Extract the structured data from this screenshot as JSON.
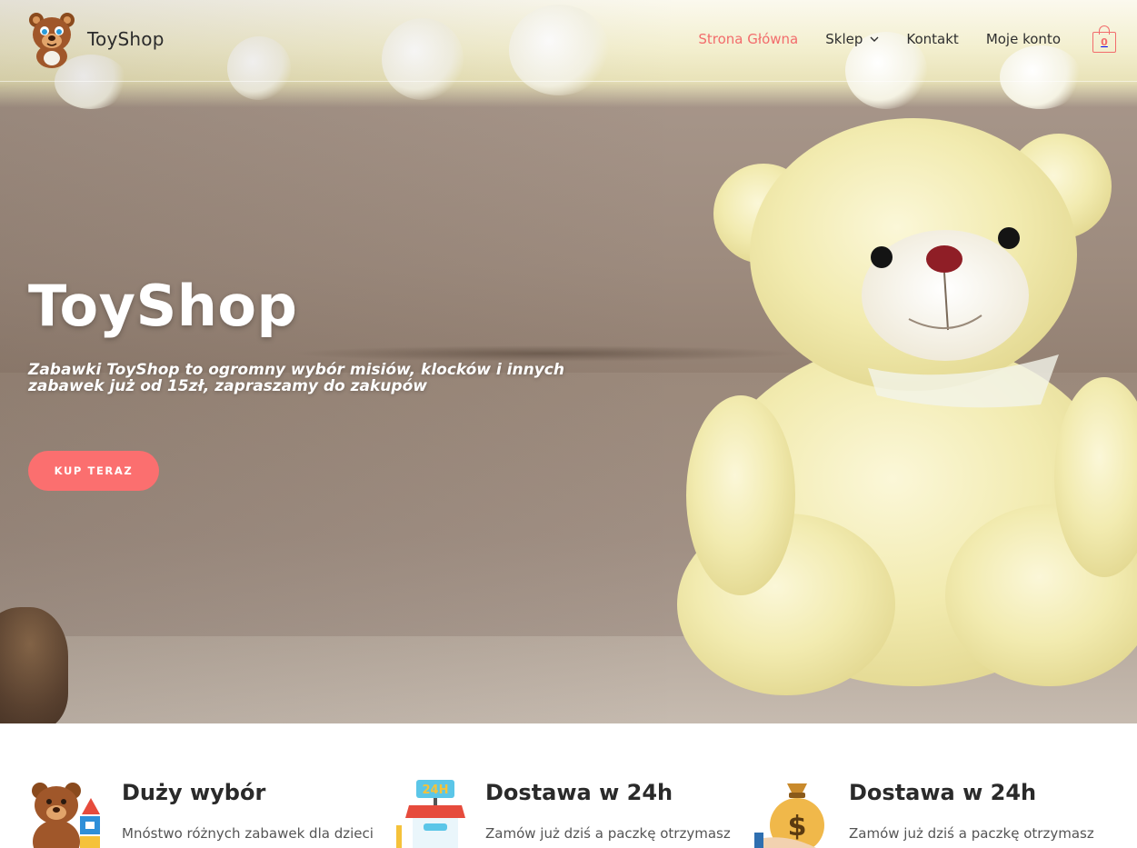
{
  "header": {
    "site_title": "ToyShop",
    "logo_icon": "teddy-bear-logo-icon",
    "nav": [
      {
        "label": "Strona Główna",
        "active": true
      },
      {
        "label": "Sklep",
        "has_dropdown": true
      },
      {
        "label": "Kontakt"
      },
      {
        "label": "Moje konto"
      }
    ],
    "cart": {
      "icon": "shopping-bag-icon",
      "count": "0"
    }
  },
  "hero": {
    "title": "ToyShop",
    "subtitle": "Zabawki ToyShop to ogromny wybór misiów, klocków i innych zabawek już od 15zł, zapraszamy do zakupów",
    "cta_label": "KUP TERAZ"
  },
  "features": [
    {
      "icon": "teddy-and-blocks-icon",
      "title": "Duży wybór",
      "text": "Mnóstwo różnych zabawek dla dzieci"
    },
    {
      "icon": "24h-store-icon",
      "title": "Dostawa w 24h",
      "text": "Zamów już dziś a paczkę otrzymasz"
    },
    {
      "icon": "money-bag-icon",
      "title": "Dostawa w 24h",
      "text": "Zamów już dziś a paczkę otrzymasz"
    }
  ],
  "colors": {
    "accent": "#f26c6c",
    "button": "#fb6f6f",
    "text": "#2b2b2b"
  }
}
